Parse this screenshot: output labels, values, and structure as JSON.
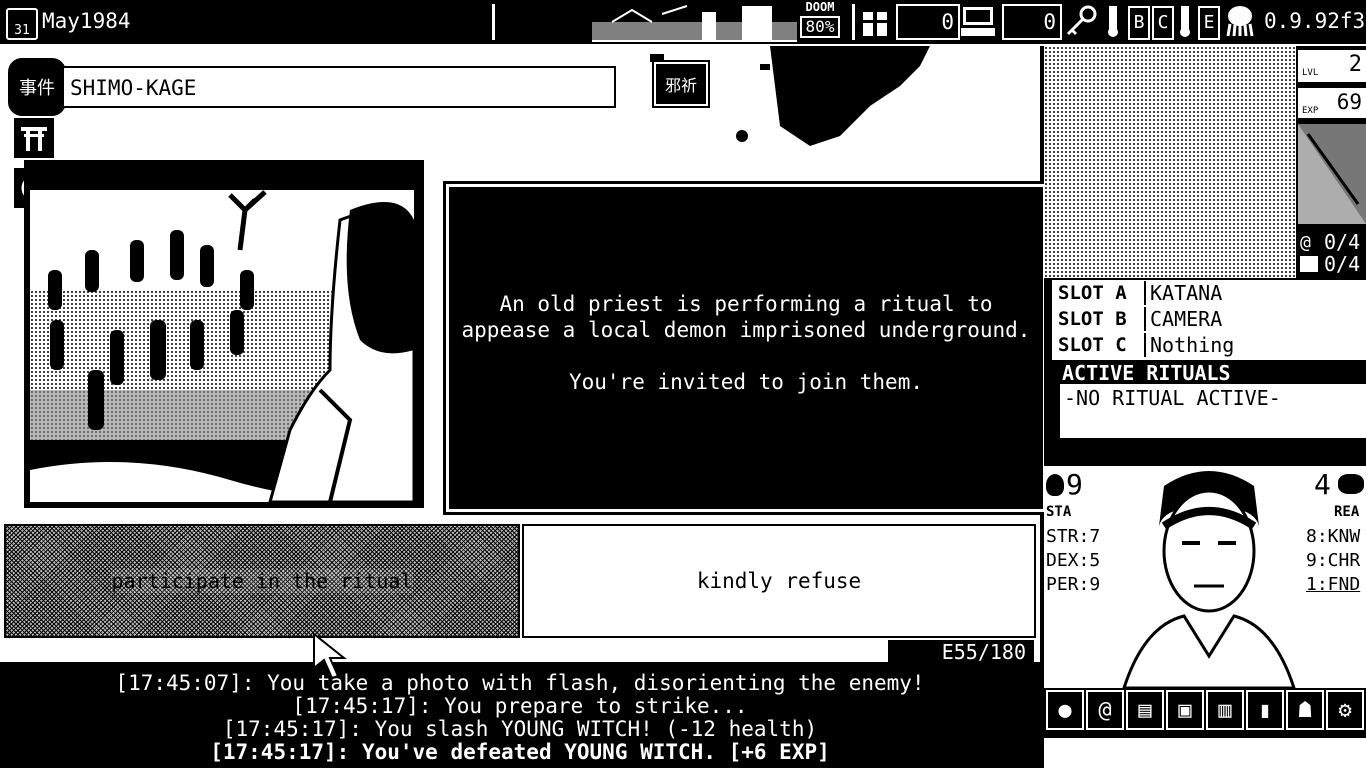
{
  "top_bar": {
    "calendar_day": "31",
    "date": "May1984",
    "doom_label": "DOOM",
    "doom_value": "80%",
    "funds": "0",
    "experience_counter": "0",
    "key_letters": [
      "B",
      "C",
      "E"
    ],
    "version": "0.9.92f3"
  },
  "event": {
    "category_glyph": "事件",
    "location_title": "SHIMO-KAGE",
    "seal_glyph": "邪祈",
    "description": "An old priest is performing a ritual to appease a local demon imprisoned underground.",
    "invitation": "You're invited to join them.",
    "choices": [
      "participate in the ritual",
      "kindly refuse"
    ],
    "event_counter": "E55/180"
  },
  "log": [
    "[17:45:07]: You take a photo with flash, disorienting the enemy!",
    "[17:45:17]: You prepare to strike...",
    "[17:45:17]: You slash YOUNG WITCH! (-12 health)",
    "[17:45:17]: You've defeated YOUNG WITCH. [+6 EXP]"
  ],
  "character": {
    "level_label": "LVL",
    "level": "2",
    "exp_label": "EXP",
    "exp": "69",
    "spells": "0/4",
    "items": "0/4",
    "slots": [
      {
        "label": "SLOT A",
        "value": "KATANA"
      },
      {
        "label": "SLOT B",
        "value": "CAMERA"
      },
      {
        "label": "SLOT C",
        "value": "Nothing"
      }
    ],
    "rituals_title": "ACTIVE RITUALS",
    "rituals_value": "-NO RITUAL ACTIVE-",
    "stamina": "9",
    "stamina_label": "STA",
    "reason": "4",
    "reason_label": "REA",
    "stats_left": [
      "STR:7",
      "DEX:5",
      "PER:9"
    ],
    "stats_right": [
      "8:KNW",
      "9:CHR",
      "1:FND"
    ]
  },
  "icons": [
    "calendar-icon",
    "tower-icon",
    "lock-icon",
    "gift-icon",
    "computer-icon",
    "key-icon",
    "thermometer-icon",
    "octopus-icon",
    "torii-icon",
    "eye-icon",
    "cthulhu-icon",
    "spiral-icon",
    "chart-icon",
    "tarot-icon",
    "building-icon",
    "door-icon",
    "octopus-icon",
    "gear-icon"
  ]
}
